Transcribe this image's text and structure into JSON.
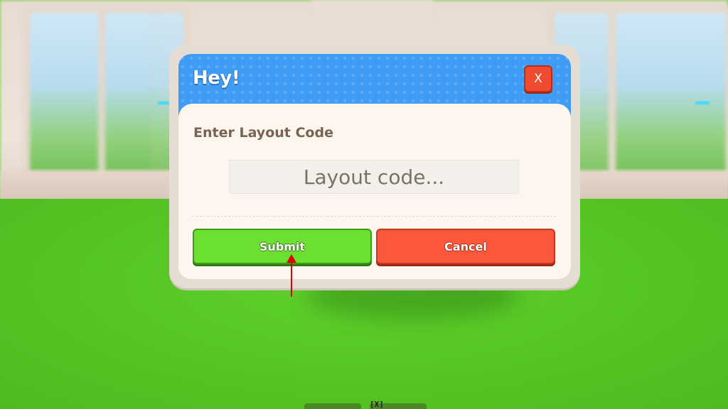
{
  "dialog": {
    "title": "Hey!",
    "close_label": "X",
    "prompt": "Enter Layout Code",
    "input": {
      "value": "",
      "placeholder": "Layout code..."
    },
    "submit_label": "Submit",
    "cancel_label": "Cancel"
  },
  "hotbar": {
    "key_hint": "[X]"
  },
  "colors": {
    "header_blue": "#3f9cf4",
    "submit_green": "#6be031",
    "cancel_red": "#fb573a",
    "close_red": "#f04a2f",
    "floor_green": "#58d026",
    "annotation_arrow": "#e00000"
  },
  "icons": {
    "pointer": "red-arrow-up-icon"
  }
}
